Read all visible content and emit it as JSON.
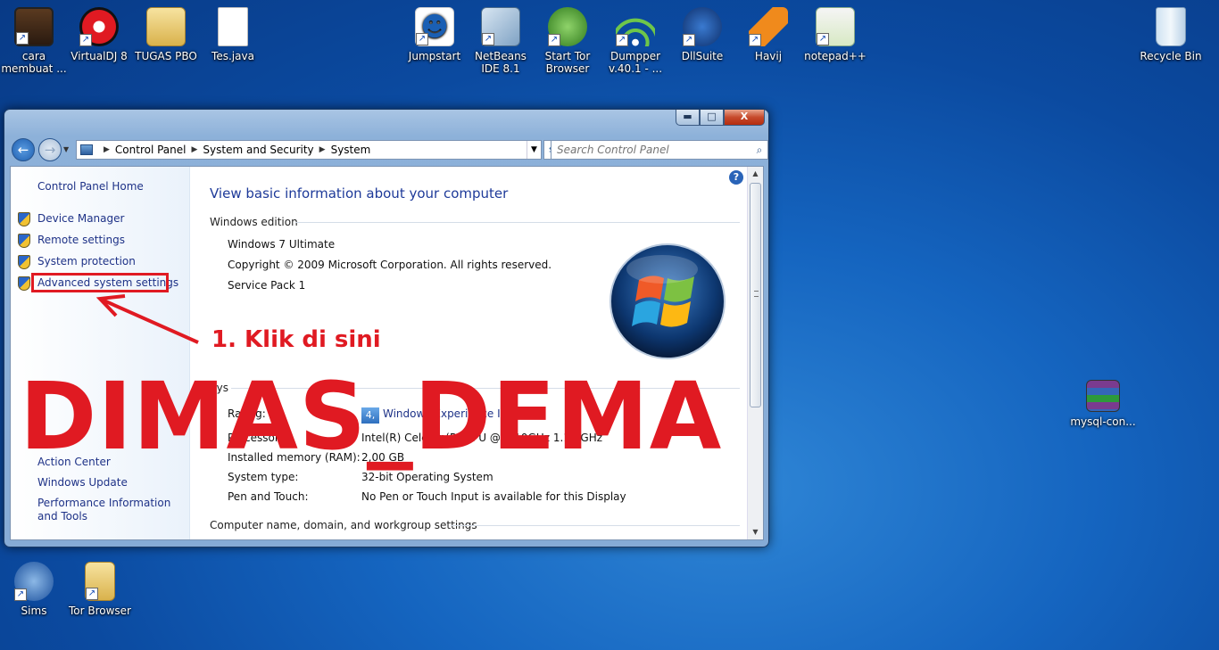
{
  "desktop": {
    "icons_top": [
      {
        "label": "cara membuat ...",
        "icon": "video-file-icon"
      },
      {
        "label": "VirtualDJ 8",
        "icon": "virtualdj-icon"
      },
      {
        "label": "TUGAS PBO",
        "icon": "folder-icon"
      },
      {
        "label": "Tes.java",
        "icon": "document-icon"
      },
      {
        "label": "Jumpstart",
        "icon": "jumpstart-icon"
      },
      {
        "label": "NetBeans IDE 8.1",
        "icon": "netbeans-icon"
      },
      {
        "label": "Start Tor Browser",
        "icon": "tor-globe-icon"
      },
      {
        "label": "Dumpper v.40.1 - ...",
        "icon": "wifi-shield-icon"
      },
      {
        "label": "DllSuite",
        "icon": "dllsuite-icon"
      },
      {
        "label": "Havij",
        "icon": "havij-icon"
      },
      {
        "label": "notepad++",
        "icon": "notepadpp-icon"
      }
    ],
    "recycle_bin": "Recycle Bin",
    "mysql_file": "mysql-con...",
    "sims": "Sims",
    "tor_browser": "Tor Browser"
  },
  "window": {
    "buttons": {
      "minimize": "▬",
      "maximize": "□",
      "close": "X"
    },
    "breadcrumb": [
      "Control Panel",
      "System and Security",
      "System"
    ],
    "search_placeholder": "Search Control Panel",
    "sidebar": {
      "home": "Control Panel Home",
      "tasks": [
        "Device Manager",
        "Remote settings",
        "System protection",
        "Advanced system settings"
      ],
      "see_also": [
        "Action Center",
        "Windows Update",
        "Performance Information and Tools"
      ]
    },
    "content": {
      "heading": "View basic information about your computer",
      "windows_edition_label": "Windows edition",
      "edition": "Windows 7 Ultimate",
      "copyright": "Copyright © 2009 Microsoft Corporation.  All rights reserved.",
      "service_pack": "Service Pack 1",
      "system_label": "Sys",
      "rating_label": "Rating:",
      "rating_value": "4,",
      "rating_link": "Windows Experience Index",
      "processor_label": "Processor:",
      "processor_value": "Intel(R) Celeron(R) CPU @ 1.10GHz  1.10 GHz",
      "memory_label": "Installed memory (RAM):",
      "memory_value": "2,00 GB",
      "system_type_label": "System type:",
      "system_type_value": "32-bit Operating System",
      "pen_label": "Pen and Touch:",
      "pen_value": "No Pen or Touch Input is available for this Display",
      "computer_name_label": "Computer name, domain, and workgroup settings"
    }
  },
  "annotation": "1. Klik di sini",
  "watermark": "DIMAS_DEMA",
  "colors": {
    "accent_red": "#e01a22",
    "link_blue": "#1e3287",
    "desktop_blue": "#1565c0"
  }
}
